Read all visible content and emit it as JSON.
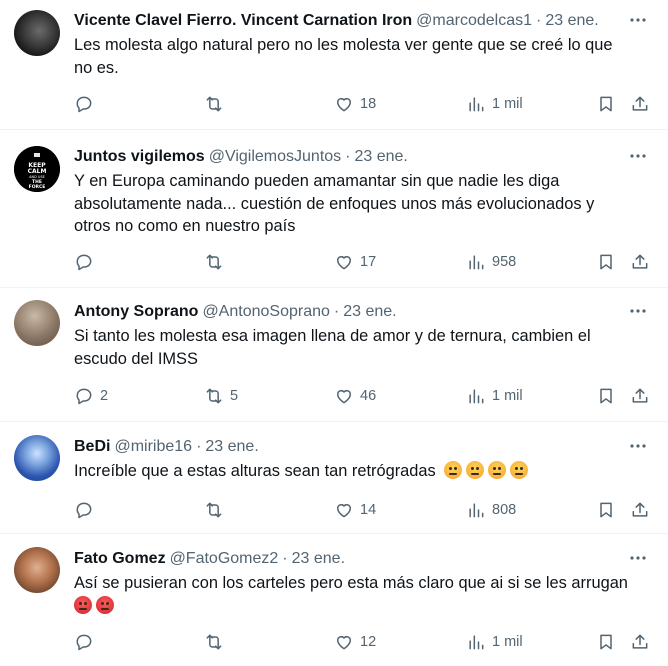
{
  "tweets": [
    {
      "name": "Vicente Clavel Fierro. Vincent Carnation Iron",
      "handle": "@marcodelcas1",
      "date": "23 ene.",
      "lines": [
        "Les molesta algo natural pero no les molesta ver gente que se creé lo que",
        "no es."
      ],
      "emojis": [],
      "replies": "",
      "retweets": "",
      "likes": "18",
      "views": "1 mil",
      "avatar_colors": [
        "#1a1a1a",
        "#6b6b6b"
      ]
    },
    {
      "name": "Juntos vigilemos",
      "handle": "@VigilemosJuntos",
      "date": "23 ene.",
      "lines": [
        "Y en Europa caminando pueden amamantar sin que nadie les diga",
        "absolutamente nada... cuestión de enfoques unos más evolucionados y",
        "otros no como en nuestro país"
      ],
      "emojis": [],
      "avatar_text": "KEEP CALM AND USE THE FORCE",
      "replies": "",
      "retweets": "",
      "likes": "17",
      "views": "958",
      "avatar_colors": [
        "#000000",
        "#333333"
      ]
    },
    {
      "name": "Antony Soprano",
      "handle": "@AntonoSoprano",
      "date": "23 ene.",
      "lines": [
        "Si tanto les molesta esa imagen llena de amor y de ternura, cambien el",
        "escudo del IMSS"
      ],
      "emojis": [],
      "replies": "2",
      "retweets": "5",
      "likes": "46",
      "views": "1 mil",
      "avatar_colors": [
        "#c9b9a6",
        "#5a4a3e"
      ]
    },
    {
      "name": "BeDi",
      "handle": "@miribe16",
      "date": "23 ene.",
      "lines": [
        "Increíble que a estas alturas sean tan retrógradas"
      ],
      "emojis": [
        "angry-face",
        "angry-face",
        "angry-face",
        "angry-face"
      ],
      "replies": "",
      "retweets": "",
      "likes": "14",
      "views": "808",
      "avatar_colors": [
        "#7fa8e0",
        "#1b3b8a"
      ]
    },
    {
      "name": "Fato Gomez",
      "handle": "@FatoGomez2",
      "date": "23 ene.",
      "lines": [
        "Así se pusieran con los carteles pero esta más claro que ai si se les arrugan"
      ],
      "emojis": [
        "pouting-face",
        "pouting-face"
      ],
      "replies": "",
      "retweets": "",
      "likes": "12",
      "views": "1 mil",
      "avatar_colors": [
        "#b0704a",
        "#3e2a1e"
      ]
    }
  ]
}
